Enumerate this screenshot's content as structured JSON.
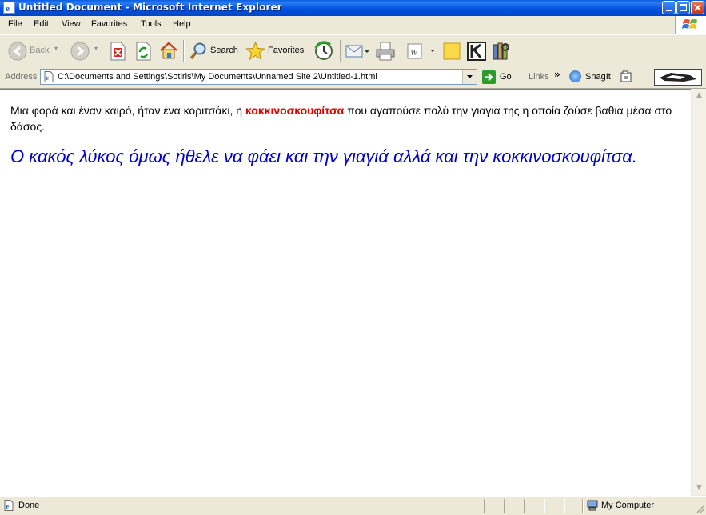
{
  "window": {
    "title": "Untitled Document - Microsoft Internet Explorer"
  },
  "menu": [
    "File",
    "Edit",
    "View",
    "Favorites",
    "Tools",
    "Help"
  ],
  "toolbar": {
    "back_label": "Back",
    "search_label": "Search",
    "favorites_label": "Favorites"
  },
  "address": {
    "label": "Address",
    "url": "C:\\Documents and Settings\\Sotiris\\My Documents\\Unnamed Site 2\\Untitled-1.html",
    "go_label": "Go",
    "links_label": "Links",
    "snagit_label": "SnagIt"
  },
  "page": {
    "para1_before": "Μια φορά και έναν καιρό, ήταν ένα κοριτσάκι, η ",
    "para1_bold": "κοκκινοσκουφίτσα",
    "para1_after": " που αγαπούσε πολύ την γιαγιά της η οποία ζούσε βαθιά μέσα στο δάσος.",
    "para2": "Ο κακός λύκος όμως ήθελε να φάει και την γιαγιά αλλά και την κοκκινοσκουφίτσα.",
    "para1_bold_color": "#e00000",
    "para2_color": "#0000cc"
  },
  "status": {
    "text": "Done",
    "zone": "My Computer"
  }
}
